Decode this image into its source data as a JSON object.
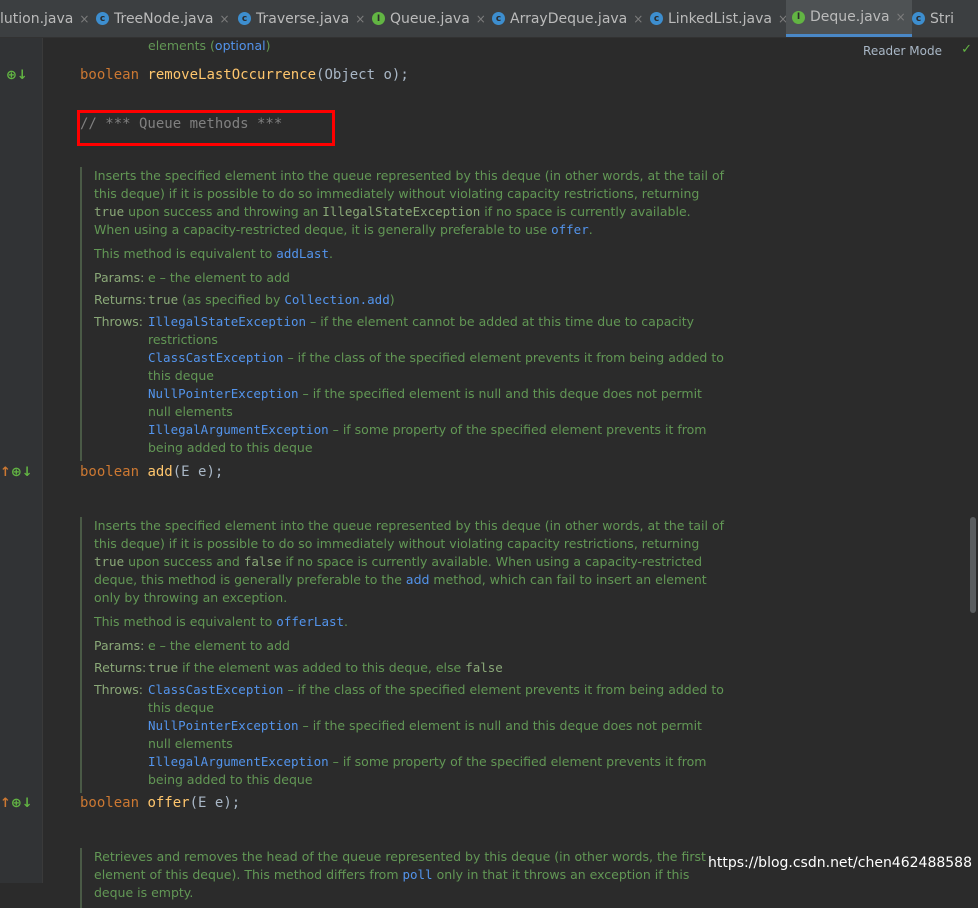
{
  "tabs": [
    {
      "label": "lution.java",
      "kind": "none",
      "close": "×"
    },
    {
      "label": "TreeNode.java",
      "kind": "class",
      "close": "×"
    },
    {
      "label": "Traverse.java",
      "kind": "class",
      "close": "×"
    },
    {
      "label": "Queue.java",
      "kind": "iface",
      "close": "×"
    },
    {
      "label": "ArrayDeque.java",
      "kind": "class",
      "close": "×"
    },
    {
      "label": "LinkedList.java",
      "kind": "class",
      "close": "×"
    },
    {
      "label": "Deque.java",
      "kind": "iface",
      "close": "×",
      "active": true
    },
    {
      "label": "Stri",
      "kind": "class",
      "close": ""
    }
  ],
  "editor": {
    "reader_mode": "Reader Mode",
    "top_fragment": {
      "text": "elements (",
      "link": "optional",
      "tail": ")"
    },
    "line_remove_last": {
      "kw": "boolean",
      "name": "removeLastOccurrence",
      "args": "(Object o);"
    },
    "comment": "// *** Queue methods ***",
    "line_add": {
      "kw": "boolean",
      "name": "add",
      "args": "(E e);"
    },
    "line_offer": {
      "kw": "boolean",
      "name": "offer",
      "args": "(E e);"
    },
    "doc_add": {
      "p1a": "Inserts the specified element into the queue represented by this deque (in other words, at the tail of this deque) if it is possible to do so immediately without violating capacity restrictions, returning ",
      "p1_true": "true",
      "p1b": " upon success and throwing an ",
      "p1_ise": "IllegalStateException",
      "p1c": " if no space is currently available. When using a capacity-restricted deque, it is generally preferable to use ",
      "p1_offer": "offer",
      "p1d": ".",
      "p2a": "This method is equivalent to ",
      "p2_link": "addLast",
      "p2b": ".",
      "params_label": "Params:",
      "params": "e – the element to add",
      "returns_label": "Returns:",
      "returns_true": "true",
      "returns_mid": " (as specified by ",
      "returns_link": "Collection.add",
      "returns_end": ")",
      "throws_label": "Throws:",
      "throws": [
        {
          "name": "IllegalStateException",
          "desc": " – if the element cannot be added at this time due to capacity restrictions"
        },
        {
          "name": "ClassCastException",
          "desc": " – if the class of the specified element prevents it from being added to this deque"
        },
        {
          "name": "NullPointerException",
          "desc": " – if the specified element is null and this deque does not permit null elements"
        },
        {
          "name": "IllegalArgumentException",
          "desc": " – if some property of the specified element prevents it from being added to this deque"
        }
      ]
    },
    "doc_offer": {
      "p1a": "Inserts the specified element into the queue represented by this deque (in other words, at the tail of this deque) if it is possible to do so immediately without violating capacity restrictions, returning ",
      "p1_true": "true",
      "p1b": " upon success and ",
      "p1_false": "false",
      "p1c": " if no space is currently available. When using a capacity-restricted deque, this method is generally preferable to the ",
      "p1_add": "add",
      "p1d": " method, which can fail to insert an element only by throwing an exception.",
      "p2a": "This method is equivalent to ",
      "p2_link": "offerLast",
      "p2b": ".",
      "params_label": "Params:",
      "params": "e – the element to add",
      "returns_label": "Returns:",
      "returns_true": "true",
      "returns_mid": " if the element was added to this deque, else ",
      "returns_false": "false",
      "throws_label": "Throws:",
      "throws": [
        {
          "name": "ClassCastException",
          "desc": " – if the class of the specified element prevents it from being added to this deque"
        },
        {
          "name": "NullPointerException",
          "desc": " – if the specified element is null and this deque does not permit null elements"
        },
        {
          "name": "IllegalArgumentException",
          "desc": " – if some property of the specified element prevents it from being added to this deque"
        }
      ]
    },
    "doc_poll": {
      "p1a": "Retrieves and removes the head of the queue represented by this deque (in other words, the first element of this deque). This method differs from ",
      "p1_poll": "poll",
      "p1b": " only in that it throws an exception if this deque is empty."
    }
  },
  "watermark": "https://blog.csdn.net/chen462488588"
}
